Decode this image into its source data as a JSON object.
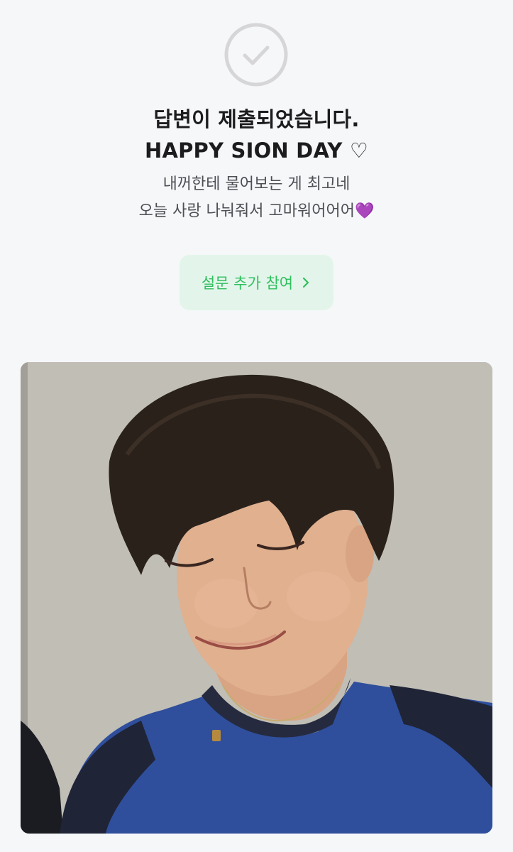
{
  "status": {
    "icon": "check-circle-icon",
    "title_line1": "답변이 제출되었습니다.",
    "title_line2": "HAPPY SION DAY ♡",
    "message_line1": "내꺼한테 물어보는 게 최고네",
    "message_line2": "오늘 사랑 나눠줘서 고마워어어어💜"
  },
  "cta": {
    "label": "설문 추가 참여",
    "icon": "chevron-right-icon",
    "text_color": "#2fbf5f",
    "background": "#e3f5ea"
  },
  "image": {
    "description_icon": "photo"
  },
  "colors": {
    "background": "#f6f7f9",
    "title": "#1c1c1e",
    "message": "#4d4f54",
    "check_icon": "#d6d6d8"
  }
}
